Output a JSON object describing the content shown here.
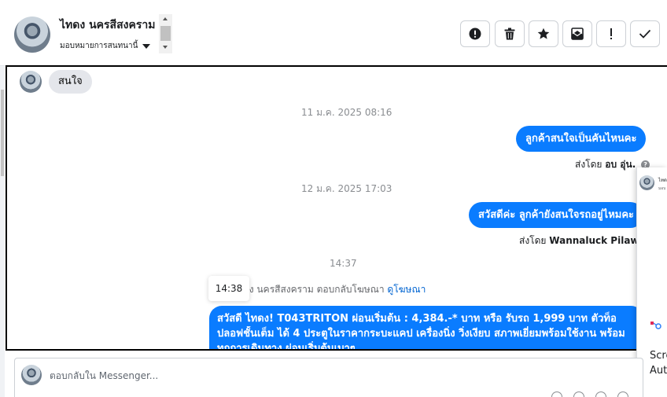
{
  "header": {
    "contact_name": "ไทดง นครสีสงคราม",
    "assign_label": "มอบหมายการสนทนานี้",
    "toolbar": [
      {
        "name": "mark-spam-button",
        "icon": "alert-circle-icon"
      },
      {
        "name": "delete-button",
        "icon": "trash-icon"
      },
      {
        "name": "star-button",
        "icon": "star-icon"
      },
      {
        "name": "archive-button",
        "icon": "archive-envelope-icon"
      },
      {
        "name": "follow-up-button",
        "icon": "exclamation-icon"
      },
      {
        "name": "mark-done-button",
        "icon": "checkmark-icon"
      }
    ]
  },
  "conversation": {
    "incoming_message": "สนใจ",
    "timestamp_1": "11 ม.ค. 2025 08:16",
    "outgoing_1": "ลูกค้าสนใจเป็นคันไหนคะ",
    "sent_by_1_prefix": "ส่งโดย",
    "sent_by_1_name": "อบ อุ่น.",
    "timestamp_2": "12 ม.ค. 2025 17:03",
    "outgoing_2": "สวัสดีค่ะ ลูกค้ายังสนใจรถอยู่ไหมคะ",
    "sent_by_2_prefix": "ส่งโดย",
    "sent_by_2_name": "Wannaluck Pilawan",
    "timestamp_3": "14:37",
    "ad_reply_text": "ดง นครสีสงคราม ตอบกลับโฆษณา",
    "ad_reply_link": "ดูโฆษณา",
    "tooltip_time": "14:38",
    "ad_message_line1": "สวัสดี ไทดง! T043TRITON ผ่อนเริ่มต้น : 4,384.-* บาท หรือ รับรถ 1,999 บาท ตัวท็อ",
    "ad_message_line2": "ปลอฟชั้นเต็ม ได้ 4 ประตูในราคากระบะแคป เครื่องนิ่ง วิ่งเงียบ สภาพเยี่ยมพร้อมใช้งาน พร้อม",
    "ad_message_line3": "ทุกการเดินทาง ผ่อนเริ่มต้นเบาๆ"
  },
  "right_panel": {
    "mini_name": "ไทด",
    "mini_sub": "มอบ",
    "text_1": "Scre",
    "text_2": "Aut"
  },
  "composer": {
    "placeholder": "ตอบกลับใน Messenger..."
  },
  "colors": {
    "messenger_blue": "#0a7cff",
    "incoming_gray": "#e4e6eb",
    "link_blue": "#0064d1"
  }
}
